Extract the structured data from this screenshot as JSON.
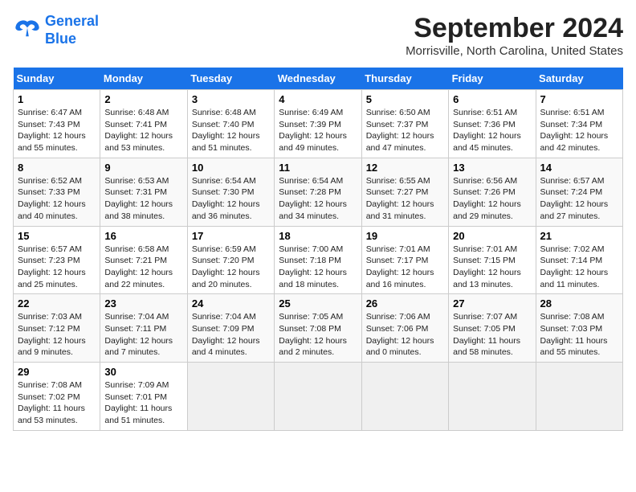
{
  "header": {
    "logo_line1": "General",
    "logo_line2": "Blue",
    "month_title": "September 2024",
    "location": "Morrisville, North Carolina, United States"
  },
  "weekdays": [
    "Sunday",
    "Monday",
    "Tuesday",
    "Wednesday",
    "Thursday",
    "Friday",
    "Saturday"
  ],
  "weeks": [
    [
      {
        "day": "1",
        "sunrise": "6:47 AM",
        "sunset": "7:43 PM",
        "daylight": "12 hours and 55 minutes."
      },
      {
        "day": "2",
        "sunrise": "6:48 AM",
        "sunset": "7:41 PM",
        "daylight": "12 hours and 53 minutes."
      },
      {
        "day": "3",
        "sunrise": "6:48 AM",
        "sunset": "7:40 PM",
        "daylight": "12 hours and 51 minutes."
      },
      {
        "day": "4",
        "sunrise": "6:49 AM",
        "sunset": "7:39 PM",
        "daylight": "12 hours and 49 minutes."
      },
      {
        "day": "5",
        "sunrise": "6:50 AM",
        "sunset": "7:37 PM",
        "daylight": "12 hours and 47 minutes."
      },
      {
        "day": "6",
        "sunrise": "6:51 AM",
        "sunset": "7:36 PM",
        "daylight": "12 hours and 45 minutes."
      },
      {
        "day": "7",
        "sunrise": "6:51 AM",
        "sunset": "7:34 PM",
        "daylight": "12 hours and 42 minutes."
      }
    ],
    [
      {
        "day": "8",
        "sunrise": "6:52 AM",
        "sunset": "7:33 PM",
        "daylight": "12 hours and 40 minutes."
      },
      {
        "day": "9",
        "sunrise": "6:53 AM",
        "sunset": "7:31 PM",
        "daylight": "12 hours and 38 minutes."
      },
      {
        "day": "10",
        "sunrise": "6:54 AM",
        "sunset": "7:30 PM",
        "daylight": "12 hours and 36 minutes."
      },
      {
        "day": "11",
        "sunrise": "6:54 AM",
        "sunset": "7:28 PM",
        "daylight": "12 hours and 34 minutes."
      },
      {
        "day": "12",
        "sunrise": "6:55 AM",
        "sunset": "7:27 PM",
        "daylight": "12 hours and 31 minutes."
      },
      {
        "day": "13",
        "sunrise": "6:56 AM",
        "sunset": "7:26 PM",
        "daylight": "12 hours and 29 minutes."
      },
      {
        "day": "14",
        "sunrise": "6:57 AM",
        "sunset": "7:24 PM",
        "daylight": "12 hours and 27 minutes."
      }
    ],
    [
      {
        "day": "15",
        "sunrise": "6:57 AM",
        "sunset": "7:23 PM",
        "daylight": "12 hours and 25 minutes."
      },
      {
        "day": "16",
        "sunrise": "6:58 AM",
        "sunset": "7:21 PM",
        "daylight": "12 hours and 22 minutes."
      },
      {
        "day": "17",
        "sunrise": "6:59 AM",
        "sunset": "7:20 PM",
        "daylight": "12 hours and 20 minutes."
      },
      {
        "day": "18",
        "sunrise": "7:00 AM",
        "sunset": "7:18 PM",
        "daylight": "12 hours and 18 minutes."
      },
      {
        "day": "19",
        "sunrise": "7:01 AM",
        "sunset": "7:17 PM",
        "daylight": "12 hours and 16 minutes."
      },
      {
        "day": "20",
        "sunrise": "7:01 AM",
        "sunset": "7:15 PM",
        "daylight": "12 hours and 13 minutes."
      },
      {
        "day": "21",
        "sunrise": "7:02 AM",
        "sunset": "7:14 PM",
        "daylight": "12 hours and 11 minutes."
      }
    ],
    [
      {
        "day": "22",
        "sunrise": "7:03 AM",
        "sunset": "7:12 PM",
        "daylight": "12 hours and 9 minutes."
      },
      {
        "day": "23",
        "sunrise": "7:04 AM",
        "sunset": "7:11 PM",
        "daylight": "12 hours and 7 minutes."
      },
      {
        "day": "24",
        "sunrise": "7:04 AM",
        "sunset": "7:09 PM",
        "daylight": "12 hours and 4 minutes."
      },
      {
        "day": "25",
        "sunrise": "7:05 AM",
        "sunset": "7:08 PM",
        "daylight": "12 hours and 2 minutes."
      },
      {
        "day": "26",
        "sunrise": "7:06 AM",
        "sunset": "7:06 PM",
        "daylight": "12 hours and 0 minutes."
      },
      {
        "day": "27",
        "sunrise": "7:07 AM",
        "sunset": "7:05 PM",
        "daylight": "11 hours and 58 minutes."
      },
      {
        "day": "28",
        "sunrise": "7:08 AM",
        "sunset": "7:03 PM",
        "daylight": "11 hours and 55 minutes."
      }
    ],
    [
      {
        "day": "29",
        "sunrise": "7:08 AM",
        "sunset": "7:02 PM",
        "daylight": "11 hours and 53 minutes."
      },
      {
        "day": "30",
        "sunrise": "7:09 AM",
        "sunset": "7:01 PM",
        "daylight": "11 hours and 51 minutes."
      },
      null,
      null,
      null,
      null,
      null
    ]
  ]
}
